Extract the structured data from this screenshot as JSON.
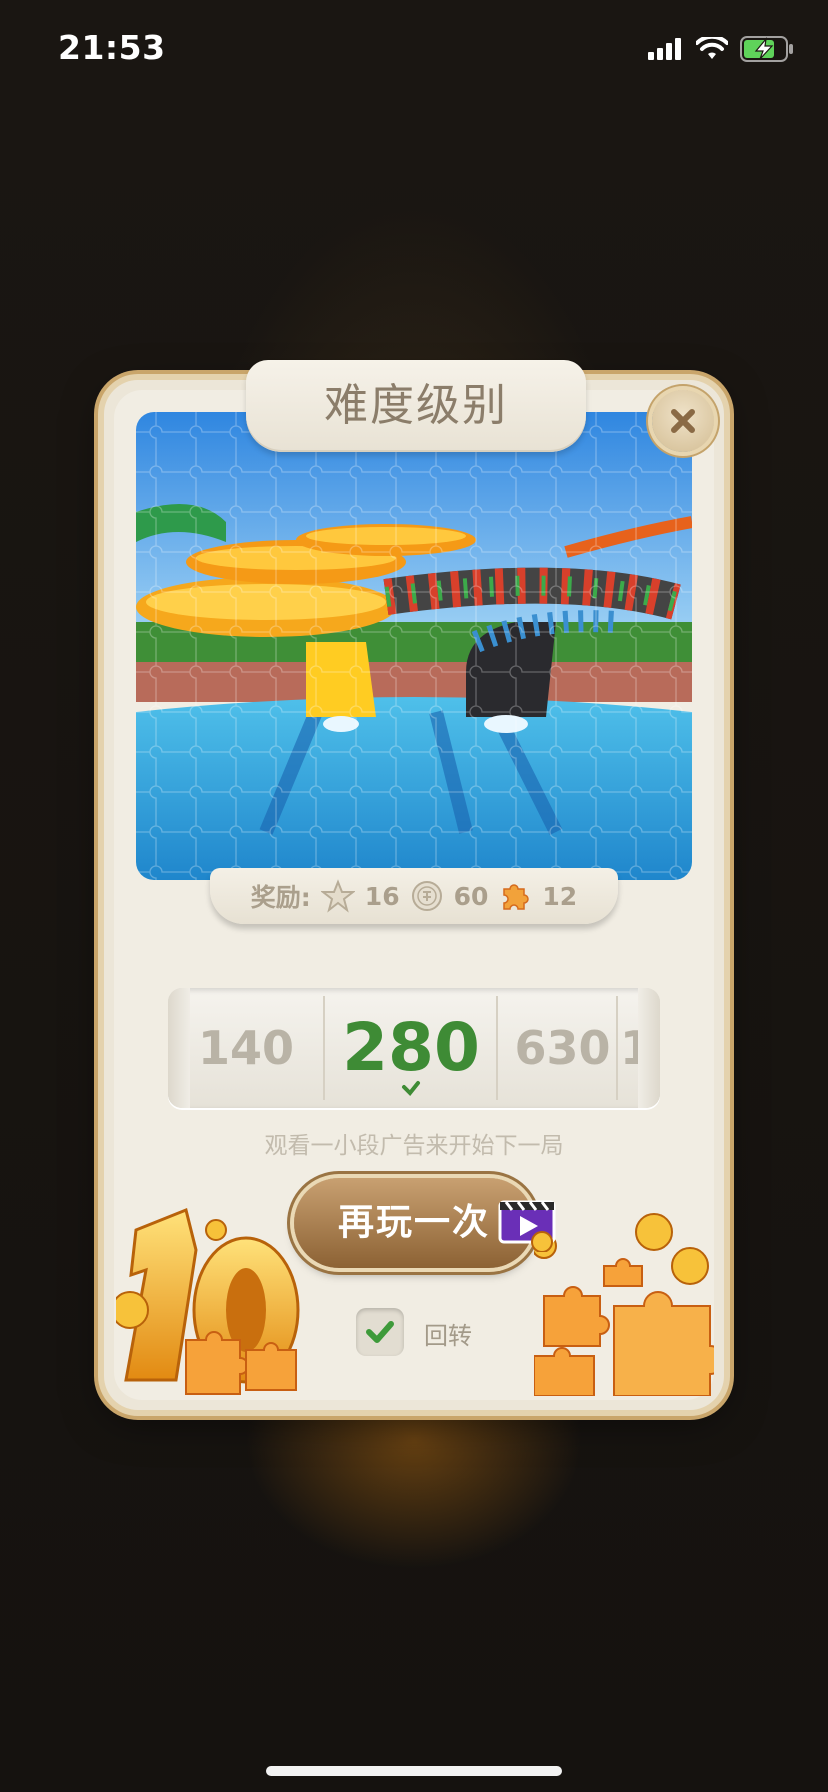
{
  "status_bar": {
    "time": "21:53",
    "icons": [
      "cellular-signal-icon",
      "wifi-icon",
      "battery-charging-icon"
    ]
  },
  "dialog": {
    "title": "难度级别",
    "close_icon": "close-x-icon",
    "image_subject": "puzzle-preview-image",
    "rewards": {
      "label": "奖励:",
      "star_count": "16",
      "coin_count": "60",
      "piece_count": "12"
    },
    "piece_selector": {
      "options": [
        "140",
        "280",
        "630",
        "1"
      ],
      "selected": "280"
    },
    "ad_hint": "观看一小段广告来开始下一局",
    "play_again_label": "再玩一次",
    "rotate_checkbox": {
      "label": "回转",
      "checked": true
    }
  },
  "colors": {
    "selected_number": "#3e8b35",
    "button_brown": "#a57a46",
    "card_bg": "#f1ede3"
  }
}
